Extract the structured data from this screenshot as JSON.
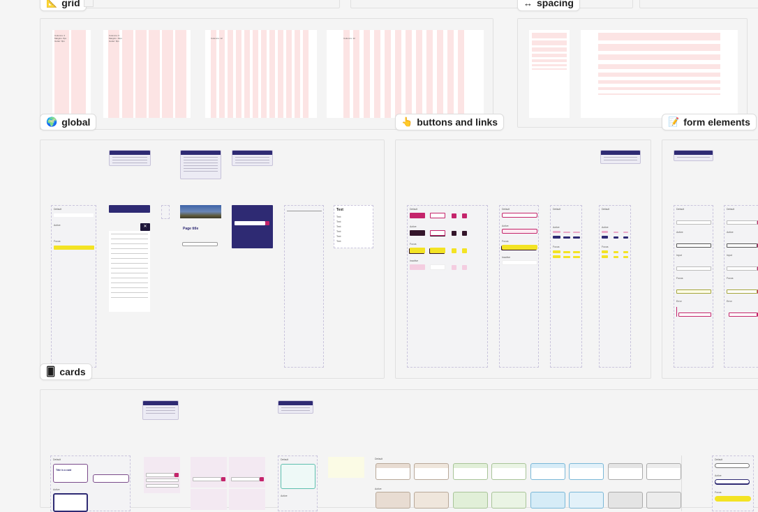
{
  "canvas": {
    "sections": {
      "grid": {
        "label": "grid",
        "icon": "triangle-ruler-icon"
      },
      "spacing": {
        "label": "spacing",
        "icon": "left-right-arrow-icon"
      },
      "global": {
        "label": "global",
        "icon": "globe-icon"
      },
      "buttons_links": {
        "label": "buttons and links",
        "icon": "pointing-hand-icon"
      },
      "form_elements": {
        "label": "form elements",
        "icon": "memo-icon"
      },
      "cards": {
        "label": "cards",
        "icon": "card-icon"
      }
    },
    "icons": {
      "triangle-ruler-icon": "📐",
      "left-right-arrow-icon": "↔",
      "globe-icon": "🌍",
      "pointing-hand-icon": "👆",
      "memo-icon": "📝",
      "card-icon": "🂠"
    },
    "global": {
      "header_states": [
        "Default",
        "Active",
        "Focus"
      ],
      "page_title": "Page title",
      "text_sample_heading": "Text",
      "text_sample_lines": [
        "Text",
        "Text",
        "Text",
        "Text",
        "Text",
        "Text",
        "Text"
      ]
    },
    "buttons": {
      "states": [
        "Default",
        "Active",
        "Focus",
        "Inactive"
      ],
      "link_states": [
        "Default",
        "Active",
        "Focus",
        "Inactive"
      ],
      "text_link_states": [
        "Default",
        "Active",
        "Focus"
      ],
      "icon_link_states": [
        "Default",
        "Active",
        "Focus"
      ]
    },
    "form": {
      "states": [
        "Default",
        "Active",
        "Input",
        "Focus",
        "Error"
      ]
    },
    "cards": {
      "states": [
        "Default",
        "Active"
      ],
      "card_title": "Title is a card",
      "focus_label": "Focus"
    },
    "colors": {
      "canvas_bg": "#f5f5f5",
      "grid_pink": "#fce4e4",
      "navy": "#2e2a73",
      "magenta": "#c4246b",
      "focus_yellow": "#f3e324",
      "dark_plum": "#34152a"
    }
  }
}
